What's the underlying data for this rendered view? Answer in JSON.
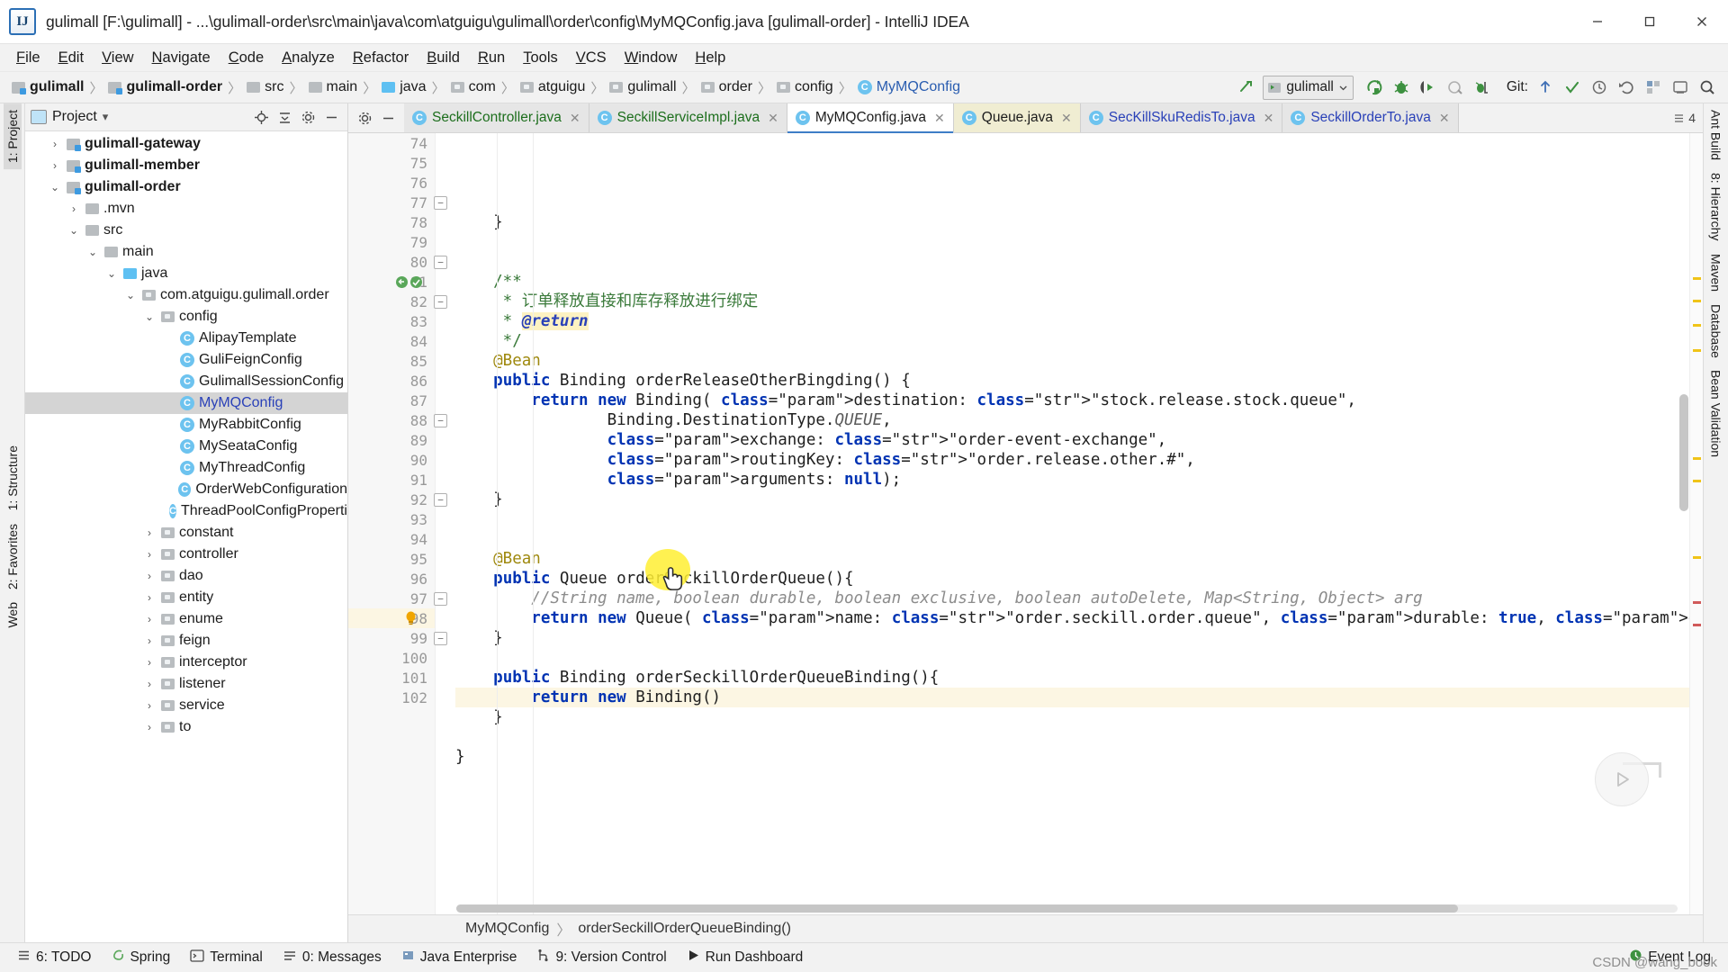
{
  "window": {
    "title": "gulimall [F:\\gulimall] - ...\\gulimall-order\\src\\main\\java\\com\\atguigu\\gulimall\\order\\config\\MyMQConfig.java [gulimall-order] - IntelliJ IDEA",
    "logo": "IJ",
    "minimize": "—",
    "maximize": "❐",
    "close": "✕"
  },
  "menu": {
    "items": [
      "File",
      "Edit",
      "View",
      "Navigate",
      "Code",
      "Analyze",
      "Refactor",
      "Build",
      "Run",
      "Tools",
      "VCS",
      "Window",
      "Help"
    ]
  },
  "navbar": {
    "crumbs": [
      {
        "label": "gulimall",
        "icon": "module-icon",
        "bold": true
      },
      {
        "label": "gulimall-order",
        "icon": "module-icon",
        "bold": true
      },
      {
        "label": "src",
        "icon": "folder-icon",
        "bold": false
      },
      {
        "label": "main",
        "icon": "folder-icon",
        "bold": false
      },
      {
        "label": "java",
        "icon": "source-folder-icon",
        "bold": false
      },
      {
        "label": "com",
        "icon": "package-icon",
        "bold": false
      },
      {
        "label": "atguigu",
        "icon": "package-icon",
        "bold": false
      },
      {
        "label": "gulimall",
        "icon": "package-icon",
        "bold": false
      },
      {
        "label": "order",
        "icon": "package-icon",
        "bold": false
      },
      {
        "label": "config",
        "icon": "package-icon",
        "bold": false
      },
      {
        "label": "MyMQConfig",
        "icon": "class-icon",
        "bold": false,
        "blue": true
      }
    ],
    "separator": "〉",
    "run_config": "gulimall",
    "git_label": "Git:",
    "toolbar_icons": [
      "build-icon",
      "run-icon",
      "debug-icon",
      "run-with-coverage-icon",
      "profile-icon",
      "attach-debugger-icon",
      "stop-icon"
    ],
    "git_icons": [
      "update-project-icon",
      "commit-icon",
      "history-icon",
      "rollback-icon",
      "search-everywhere-icon"
    ]
  },
  "project_pane": {
    "title": "Project",
    "dropdown": "▾",
    "header_buttons": [
      "locate-icon",
      "collapse-all-icon",
      "settings-icon",
      "hide-icon"
    ],
    "tree": [
      {
        "label": "gulimall-gateway",
        "depth": 1,
        "arrow": "›",
        "icon": "module-icon",
        "bold": true,
        "selected": false
      },
      {
        "label": "gulimall-member",
        "depth": 1,
        "arrow": "›",
        "icon": "module-icon",
        "bold": true,
        "selected": false
      },
      {
        "label": "gulimall-order",
        "depth": 1,
        "arrow": "⌄",
        "icon": "module-icon",
        "bold": true,
        "selected": false
      },
      {
        "label": ".mvn",
        "depth": 2,
        "arrow": "›",
        "icon": "folder-icon",
        "bold": false,
        "selected": false
      },
      {
        "label": "src",
        "depth": 2,
        "arrow": "⌄",
        "icon": "folder-icon",
        "bold": false,
        "selected": false
      },
      {
        "label": "main",
        "depth": 3,
        "arrow": "⌄",
        "icon": "folder-icon",
        "bold": false,
        "selected": false
      },
      {
        "label": "java",
        "depth": 4,
        "arrow": "⌄",
        "icon": "source-folder-icon",
        "bold": false,
        "selected": false
      },
      {
        "label": "com.atguigu.gulimall.order",
        "depth": 5,
        "arrow": "⌄",
        "icon": "package-icon",
        "bold": false,
        "selected": false
      },
      {
        "label": "config",
        "depth": 6,
        "arrow": "⌄",
        "icon": "package-icon",
        "bold": false,
        "selected": false
      },
      {
        "label": "AlipayTemplate",
        "depth": 7,
        "arrow": "",
        "icon": "class-icon",
        "bold": false,
        "selected": false
      },
      {
        "label": "GuliFeignConfig",
        "depth": 7,
        "arrow": "",
        "icon": "class-icon",
        "bold": false,
        "selected": false
      },
      {
        "label": "GulimallSessionConfig",
        "depth": 7,
        "arrow": "",
        "icon": "class-icon",
        "bold": false,
        "selected": false
      },
      {
        "label": "MyMQConfig",
        "depth": 7,
        "arrow": "",
        "icon": "class-icon",
        "bold": false,
        "selected": true
      },
      {
        "label": "MyRabbitConfig",
        "depth": 7,
        "arrow": "",
        "icon": "class-icon",
        "bold": false,
        "selected": false
      },
      {
        "label": "MySeataConfig",
        "depth": 7,
        "arrow": "",
        "icon": "class-icon",
        "bold": false,
        "selected": false
      },
      {
        "label": "MyThreadConfig",
        "depth": 7,
        "arrow": "",
        "icon": "class-icon",
        "bold": false,
        "selected": false
      },
      {
        "label": "OrderWebConfiguration",
        "depth": 7,
        "arrow": "",
        "icon": "class-icon",
        "bold": false,
        "selected": false
      },
      {
        "label": "ThreadPoolConfigProperties",
        "depth": 7,
        "arrow": "",
        "icon": "class-icon",
        "bold": false,
        "selected": false
      },
      {
        "label": "constant",
        "depth": 6,
        "arrow": "›",
        "icon": "package-icon",
        "bold": false,
        "selected": false
      },
      {
        "label": "controller",
        "depth": 6,
        "arrow": "›",
        "icon": "package-icon",
        "bold": false,
        "selected": false
      },
      {
        "label": "dao",
        "depth": 6,
        "arrow": "›",
        "icon": "package-icon",
        "bold": false,
        "selected": false
      },
      {
        "label": "entity",
        "depth": 6,
        "arrow": "›",
        "icon": "package-icon",
        "bold": false,
        "selected": false
      },
      {
        "label": "enume",
        "depth": 6,
        "arrow": "›",
        "icon": "package-icon",
        "bold": false,
        "selected": false
      },
      {
        "label": "feign",
        "depth": 6,
        "arrow": "›",
        "icon": "package-icon",
        "bold": false,
        "selected": false
      },
      {
        "label": "interceptor",
        "depth": 6,
        "arrow": "›",
        "icon": "package-icon",
        "bold": false,
        "selected": false
      },
      {
        "label": "listener",
        "depth": 6,
        "arrow": "›",
        "icon": "package-icon",
        "bold": false,
        "selected": false
      },
      {
        "label": "service",
        "depth": 6,
        "arrow": "›",
        "icon": "package-icon",
        "bold": false,
        "selected": false
      },
      {
        "label": "to",
        "depth": 6,
        "arrow": "›",
        "icon": "package-icon",
        "bold": false,
        "selected": false
      }
    ]
  },
  "editor_tabs": {
    "tabs": [
      {
        "label": "SeckillController.java",
        "color": "green",
        "state": "normal"
      },
      {
        "label": "SeckillServiceImpl.java",
        "color": "green",
        "state": "normal"
      },
      {
        "label": "MyMQConfig.java",
        "color": "dark",
        "state": "active"
      },
      {
        "label": "Queue.java",
        "color": "dark",
        "state": "yellow"
      },
      {
        "label": "SecKillSkuRedisTo.java",
        "color": "blue",
        "state": "normal"
      },
      {
        "label": "SeckillOrderTo.java",
        "color": "blue",
        "state": "normal"
      }
    ],
    "close_glyph": "✕",
    "overflow_label": "4",
    "left_buttons": [
      "settings-icon",
      "hide-icon"
    ]
  },
  "code": {
    "first_line": 74,
    "current_line": 98,
    "lines": [
      {
        "n": 74,
        "text": "    }"
      },
      {
        "n": 75,
        "text": ""
      },
      {
        "n": 76,
        "text": ""
      },
      {
        "n": 77,
        "text": "    /**",
        "fold": "minus"
      },
      {
        "n": 78,
        "text": "     * 订单释放直接和库存释放进行绑定"
      },
      {
        "n": 79,
        "text": "     * @return"
      },
      {
        "n": 80,
        "text": "     */",
        "fold": "minus"
      },
      {
        "n": 81,
        "text": "    @Bean",
        "gutter_icons": "override-implement"
      },
      {
        "n": 82,
        "text": "    public Binding orderReleaseOtherBingding() {",
        "fold": "minus"
      },
      {
        "n": 83,
        "text": "        return new Binding( destination: \"stock.release.stock.queue\","
      },
      {
        "n": 84,
        "text": "                Binding.DestinationType.QUEUE,"
      },
      {
        "n": 85,
        "text": "                exchange: \"order-event-exchange\","
      },
      {
        "n": 86,
        "text": "                routingKey: \"order.release.other.#\","
      },
      {
        "n": 87,
        "text": "                arguments: null);"
      },
      {
        "n": 88,
        "text": "    }",
        "fold": "minus"
      },
      {
        "n": 89,
        "text": ""
      },
      {
        "n": 90,
        "text": ""
      },
      {
        "n": 91,
        "text": "    @Bean"
      },
      {
        "n": 92,
        "text": "    public Queue orderSeckillOrderQueue(){",
        "fold": "minus"
      },
      {
        "n": 93,
        "text": "        //String name, boolean durable, boolean exclusive, boolean autoDelete, Map<String, Object> arg"
      },
      {
        "n": 94,
        "text": "        return new Queue( name: \"order.seckill.order.queue\", durable: true, exclusive: false, autoDelete: fal"
      },
      {
        "n": 95,
        "text": "    }"
      },
      {
        "n": 96,
        "text": ""
      },
      {
        "n": 97,
        "text": "    public Binding orderSeckillOrderQueueBinding(){",
        "fold": "minus"
      },
      {
        "n": 98,
        "text": "        return new Binding()",
        "current": true,
        "bulb": true
      },
      {
        "n": 99,
        "text": "    }",
        "fold": "minus"
      },
      {
        "n": 100,
        "text": ""
      },
      {
        "n": 101,
        "text": "}"
      },
      {
        "n": 102,
        "text": ""
      }
    ]
  },
  "breadcrumb_bottom": {
    "parts": [
      "MyMQConfig",
      "orderSeckillOrderQueueBinding()"
    ],
    "separator": "〉"
  },
  "status_bar": {
    "left_items": [
      {
        "label": "6: TODO",
        "icon": "todo-icon"
      },
      {
        "label": "Spring",
        "icon": "spring-icon"
      },
      {
        "label": "Terminal",
        "icon": "terminal-icon"
      },
      {
        "label": "0: Messages",
        "icon": "messages-icon"
      },
      {
        "label": "Java Enterprise",
        "icon": "java-enterprise-icon"
      },
      {
        "label": "9: Version Control",
        "icon": "version-control-icon"
      },
      {
        "label": "Run Dashboard",
        "icon": "run-dashboard-icon"
      }
    ],
    "right_items": [
      {
        "label": "Event Log",
        "icon": "event-log-icon"
      }
    ]
  },
  "left_tool_window_bar": [
    {
      "label": "1: Project",
      "selected": true
    },
    {
      "label": "1: Structure",
      "selected": false
    },
    {
      "label": "2: Favorites",
      "selected": false
    },
    {
      "label": "Web",
      "selected": false
    }
  ],
  "right_tool_window_bar": [
    {
      "label": "Ant Build"
    },
    {
      "label": "8: Hierarchy"
    },
    {
      "label": "Maven"
    },
    {
      "label": "Database"
    },
    {
      "label": "Bean Validation"
    }
  ],
  "watermark": "CSDN @wang_book",
  "colors": {
    "accent": "#3e7ec7",
    "keyword": "#0033b3",
    "string": "#067d17",
    "comment": "#8c8c8c",
    "javadoc": "#3a7a3a",
    "annotation": "#9e880d",
    "current_line": "#fcf6e3",
    "selection": "#d4d4d4",
    "cursor_highlight": "#ffee33"
  }
}
